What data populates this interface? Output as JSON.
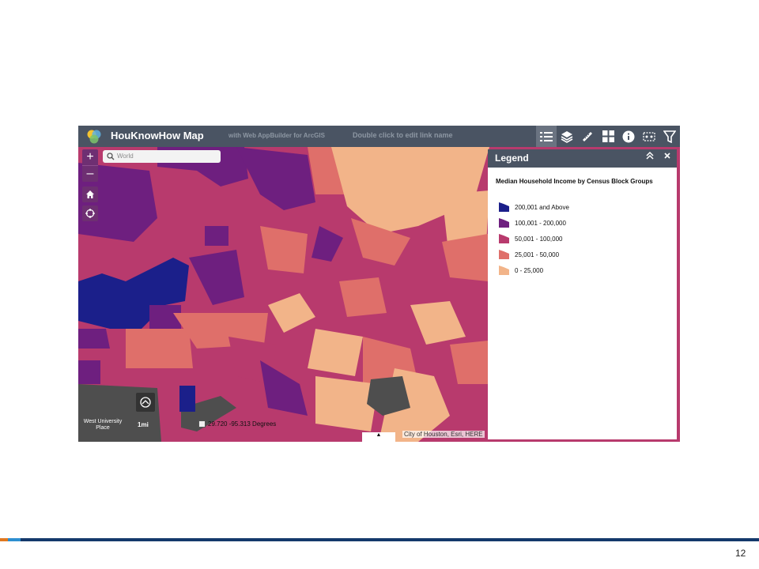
{
  "app": {
    "title": "HouKnowHow Map",
    "subtitle": "with Web AppBuilder for ArcGIS",
    "link_name": "Double click to edit link name"
  },
  "toolbar": {
    "icons": [
      "legend-icon",
      "layers-icon",
      "measure-icon",
      "basemap-gallery-icon",
      "about-icon",
      "select-icon",
      "filter-icon"
    ]
  },
  "search": {
    "placeholder": "World"
  },
  "zoom": {
    "in": "+",
    "out": "–"
  },
  "legend": {
    "title": "Legend",
    "layer_title": "Median Household Income by Census Block Groups",
    "items": [
      {
        "label": "200,001 and Above",
        "color": "#1b1f8a"
      },
      {
        "label": "100,001 - 200,000",
        "color": "#6e1f7f"
      },
      {
        "label": "50,001 - 100,000",
        "color": "#b83a6d"
      },
      {
        "label": "25,001 - 50,000",
        "color": "#df6f6a"
      },
      {
        "label": "0 - 25,000",
        "color": "#f2b489"
      }
    ]
  },
  "map": {
    "coords": "29.720  -95.313 Degrees",
    "attribution": "City of Houston, Esri, HERE",
    "place_label": "West University Place",
    "scale": "1mi"
  },
  "slide": {
    "page_number": "12"
  }
}
